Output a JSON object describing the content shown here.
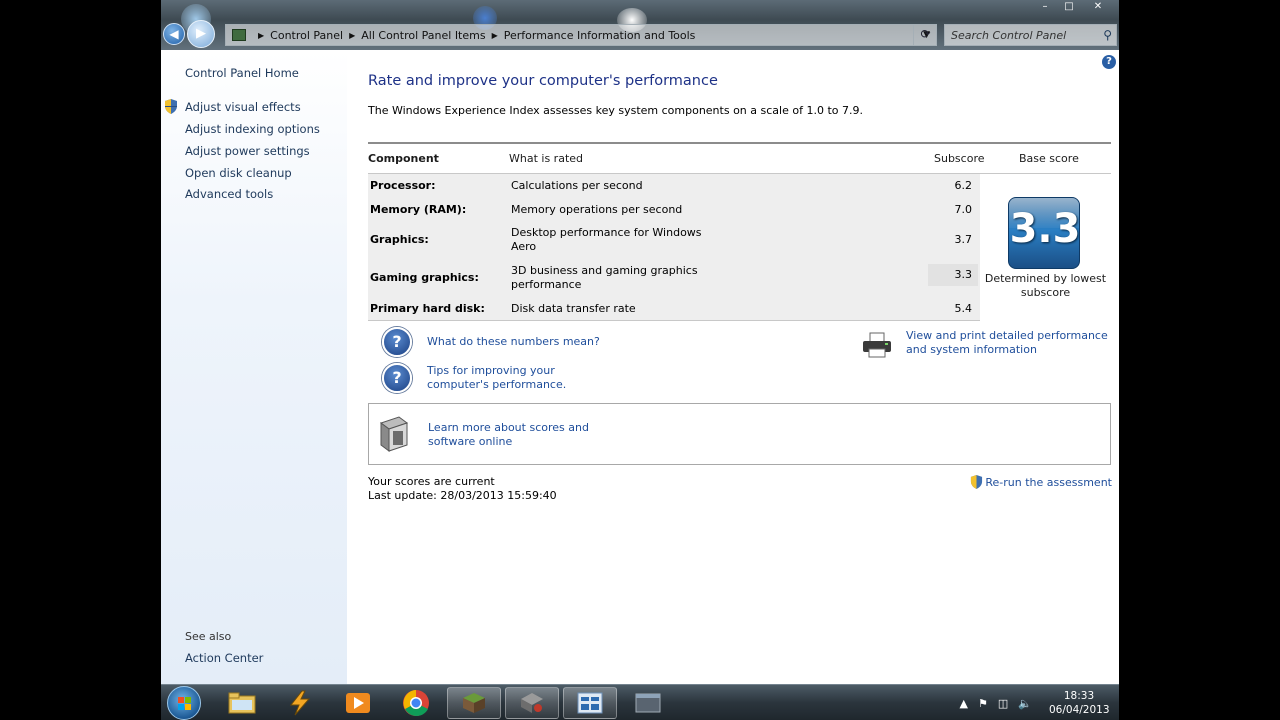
{
  "window": {
    "address_crumbs": [
      "Control Panel",
      "All Control Panel Items",
      "Performance Information and Tools"
    ],
    "search_placeholder": "Search Control Panel",
    "help_label": "?"
  },
  "sidebar": {
    "home": "Control Panel Home",
    "items": [
      {
        "label": "Adjust visual effects",
        "shield": true
      },
      {
        "label": "Adjust indexing options",
        "shield": false
      },
      {
        "label": "Adjust power settings",
        "shield": false
      },
      {
        "label": "Open disk cleanup",
        "shield": false
      },
      {
        "label": "Advanced tools",
        "shield": false
      }
    ],
    "see_also_title": "See also",
    "see_also_items": [
      "Action Center"
    ]
  },
  "main": {
    "title": "Rate and improve your computer's performance",
    "intro": "The Windows Experience Index assesses key system components on a scale of 1.0 to 7.9.",
    "table": {
      "headers": {
        "component": "Component",
        "rated": "What is rated",
        "subscore": "Subscore",
        "base": "Base score"
      },
      "rows": [
        {
          "component": "Processor:",
          "rated": "Calculations per second",
          "subscore": "6.2"
        },
        {
          "component": "Memory (RAM):",
          "rated": "Memory operations per second",
          "subscore": "7.0"
        },
        {
          "component": "Graphics:",
          "rated": "Desktop performance for Windows Aero",
          "subscore": "3.7"
        },
        {
          "component": "Gaming graphics:",
          "rated": "3D business and gaming graphics performance",
          "subscore": "3.3"
        },
        {
          "component": "Primary hard disk:",
          "rated": "Disk data transfer rate",
          "subscore": "5.4"
        }
      ],
      "base_score": "3.3",
      "base_caption": "Determined by lowest subscore"
    },
    "links": {
      "numbers_meaning": "What do these numbers mean?",
      "tips": "Tips for improving your computer's performance.",
      "view_print": "View and print detailed performance and system information",
      "learn_more": "Learn more about scores and software online"
    },
    "status": {
      "current": "Your scores are current",
      "last_update": "Last update: 28/03/2013 15:59:40",
      "rerun": "Re-run the assessment"
    }
  },
  "taskbar": {
    "apps": [
      "start-orb",
      "windows-explorer",
      "winamp",
      "media-player",
      "google-chrome",
      "minecraft",
      "app-icon-6",
      "control-panel",
      "app-icon-8"
    ],
    "time": "18:33",
    "date": "06/04/2013"
  },
  "colors": {
    "link": "#1f4e9b",
    "title": "#1e3287",
    "score_tile": "#2a7fc4"
  }
}
